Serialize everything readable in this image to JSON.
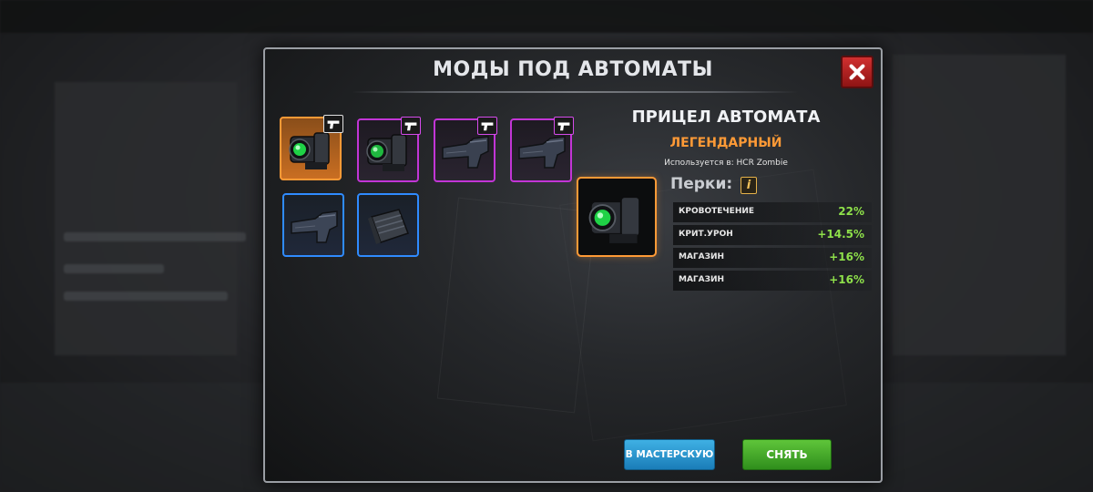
{
  "dialog": {
    "title": "МОДЫ ПОД АВТОМАТЫ"
  },
  "inventory": {
    "slots": [
      {
        "item": "scope",
        "rarity": "legendary",
        "selected": true,
        "badge": "pistol-icon"
      },
      {
        "item": "scope",
        "rarity": "epic",
        "badge": "pistol-icon"
      },
      {
        "item": "stock",
        "rarity": "epic",
        "badge": "pistol-icon"
      },
      {
        "item": "stock",
        "rarity": "epic",
        "badge": "pistol-icon"
      },
      {
        "item": "stock",
        "rarity": "rare"
      },
      {
        "item": "magazine",
        "rarity": "rare"
      }
    ]
  },
  "details": {
    "name": "ПРИЦЕЛ АВТОМАТА",
    "rarity": "ЛЕГЕНДАРНЫЙ",
    "used_in": "Используется в: HCR Zombie",
    "perks_label": "Перки:",
    "info_icon": "i",
    "perks": [
      {
        "name": "КРОВОТЕЧЕНИЕ",
        "value": "22%"
      },
      {
        "name": "КРИТ.УРОН",
        "value": "+14.5%"
      },
      {
        "name": "МАГАЗИН",
        "value": "+16%"
      },
      {
        "name": "МАГАЗИН",
        "value": "+16%"
      }
    ]
  },
  "buttons": {
    "workshop": "В МАСТЕРСКУЮ",
    "remove": "СНЯТЬ"
  },
  "colors": {
    "legendary": "#ff9a36",
    "epic": "#c235d6",
    "rare": "#2f8bff",
    "perk_value": "#8ee04a",
    "close": "#c62828",
    "workshop_button": "#2a9ad4",
    "remove_button": "#4aab2c"
  }
}
